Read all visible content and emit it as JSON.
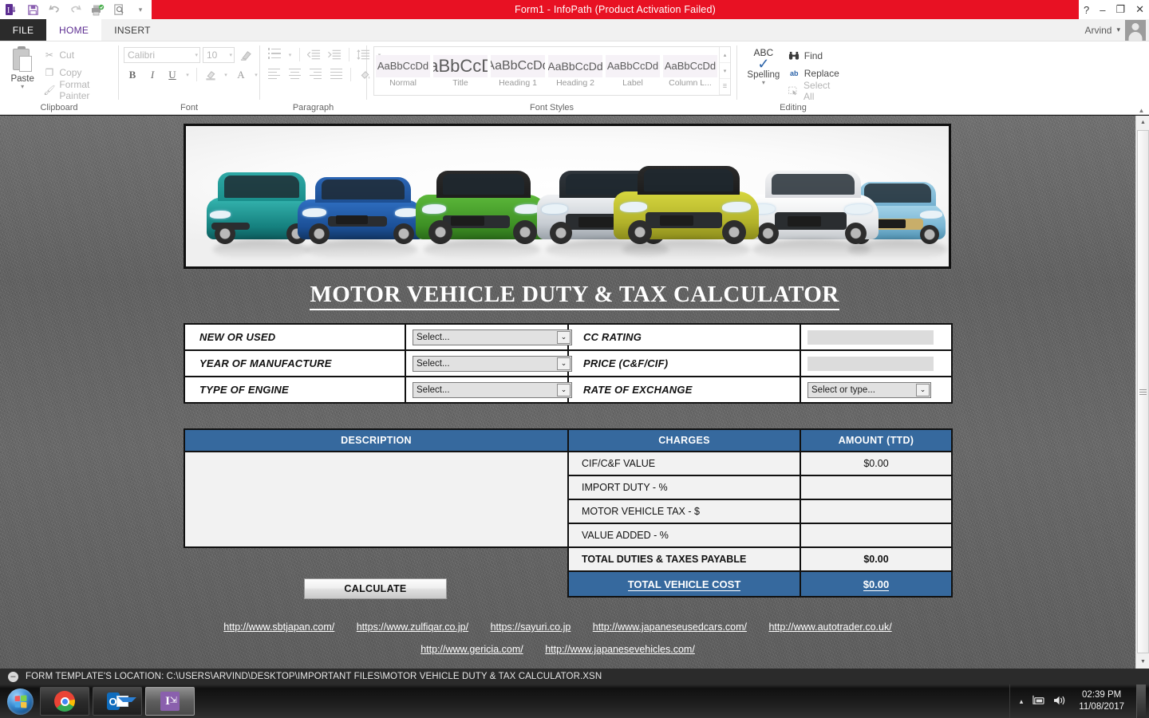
{
  "window": {
    "title": "Form1 -  InfoPath (Product Activation Failed)",
    "help_icon": "?",
    "minimize_icon": "–",
    "restore_icon": "❐",
    "close_icon": "✕",
    "user_name": "Arvind",
    "user_caret": "▾"
  },
  "quick_access": [
    {
      "name": "infopath-logo-icon",
      "glyph": "I"
    },
    {
      "name": "save-icon",
      "glyph": "▤"
    },
    {
      "name": "undo-icon",
      "glyph": "↶"
    },
    {
      "name": "redo-icon",
      "glyph": "↷"
    },
    {
      "name": "quick-publish-icon",
      "glyph": "⎙"
    },
    {
      "name": "preview-icon",
      "glyph": "🔍"
    },
    {
      "name": "customize-qat-icon",
      "glyph": "▾"
    }
  ],
  "tabs": {
    "file": "FILE",
    "items": [
      {
        "label": "HOME",
        "active": true
      },
      {
        "label": "INSERT",
        "active": false
      }
    ]
  },
  "ribbon": {
    "clipboard": {
      "group_label": "Clipboard",
      "paste_label": "Paste",
      "paste_caret": "▾",
      "commands": [
        {
          "label": "Cut",
          "icon": "scissors-icon",
          "glyph": "✂"
        },
        {
          "label": "Copy",
          "icon": "copy-icon",
          "glyph": "❐"
        },
        {
          "label": "Format Painter",
          "icon": "format-painter-icon",
          "glyph": "✎"
        }
      ]
    },
    "font": {
      "group_label": "Font",
      "font_name": "Calibri",
      "font_size": "10",
      "caret": "▾",
      "clear_formatting_icon": "clear-formatting-icon",
      "bold": "B",
      "italic": "I",
      "underline": "U",
      "highlight_icon": "text-highlight-icon",
      "font_color": "A"
    },
    "paragraph": {
      "group_label": "Paragraph",
      "bullets_icon": "bullet-list-icon",
      "decrease_indent_icon": "decrease-indent-icon",
      "increase_indent_icon": "increase-indent-icon",
      "line_spacing_icon": "line-spacing-icon",
      "align_left_icon": "align-left-icon",
      "align_center_icon": "align-center-icon",
      "align_right_icon": "align-right-icon",
      "justify_icon": "justify-icon",
      "shading_icon": "shading-icon"
    },
    "font_styles": {
      "group_label": "Font Styles",
      "styles": [
        {
          "preview": "AaBbCcDd",
          "name": "Normal",
          "size": "13px"
        },
        {
          "preview": "AaBbCcDd",
          "name": "Title",
          "size": "22px"
        },
        {
          "preview": "AaBbCcDd",
          "name": "Heading 1",
          "size": "16px"
        },
        {
          "preview": "AaBbCcDd",
          "name": "Heading 2",
          "size": "14px"
        },
        {
          "preview": "AaBbCcDd",
          "name": "Label",
          "size": "13px"
        },
        {
          "preview": "AaBbCcDd",
          "name": "Column L...",
          "size": "13px"
        }
      ],
      "scroll_up": "▴",
      "scroll_down": "▾",
      "scroll_more": "☰"
    },
    "editing": {
      "group_label": "Editing",
      "spelling_abc": "ABC",
      "spelling_label": "Spelling",
      "spelling_caret": "▾",
      "commands": [
        {
          "label": "Find",
          "icon": "binoculars-icon",
          "glyph": "🔍"
        },
        {
          "label": "Replace",
          "icon": "replace-icon",
          "glyph": "ab"
        },
        {
          "label": "Select All",
          "icon": "select-all-icon",
          "glyph": "▣"
        }
      ]
    },
    "collapse_ribbon_icon": "▲"
  },
  "form": {
    "banner_alt": "vehicle-lineup-banner",
    "title": "MOTOR VEHICLE DUTY & TAX CALCULATOR",
    "inputs": [
      {
        "label": "NEW OR USED",
        "control": "select",
        "value": "Select..."
      },
      {
        "label": "CC RATING",
        "control": "text",
        "value": ""
      },
      {
        "label": "YEAR OF MANUFACTURE",
        "control": "select",
        "value": "Select..."
      },
      {
        "label": "PRICE (C&F/CIF)",
        "control": "text",
        "value": ""
      },
      {
        "label": "TYPE OF ENGINE",
        "control": "select",
        "value": "Select..."
      },
      {
        "label": "RATE OF EXCHANGE",
        "control": "combo",
        "value": "Select or type..."
      }
    ],
    "table": {
      "headers": [
        "DESCRIPTION",
        "CHARGES",
        "AMOUNT (TTD)"
      ],
      "rows": [
        {
          "charge": "CIF/C&F VALUE",
          "amount": "$0.00",
          "bold": false
        },
        {
          "charge": "IMPORT DUTY -     %",
          "amount": "",
          "bold": false
        },
        {
          "charge": "MOTOR VEHICLE TAX - $",
          "amount": "",
          "bold": false
        },
        {
          "charge": "VALUE ADDED -       %",
          "amount": "",
          "bold": false
        }
      ],
      "total_row": {
        "charge": "TOTAL DUTIES & TAXES PAYABLE",
        "amount": "$0.00"
      },
      "grand_row": {
        "charge": "TOTAL VEHICLE COST",
        "amount": "$0.00"
      }
    },
    "calculate_button": "CALCULATE",
    "links_row1": [
      "http://www.sbtjapan.com/",
      "https://www.zulfiqar.co.jp/",
      "https://sayuri.co.jp",
      "http://www.japaneseusedcars.com/",
      "http://www.autotrader.co.uk/"
    ],
    "links_row2": [
      "http://www.gericia.com/",
      "http://www.japanesevehicles.com/"
    ],
    "dropdown_arrow": "⌄"
  },
  "colors": {
    "accent_blue": "#36699E",
    "title_red": "#e81123",
    "file_tab": "#2b2b2b",
    "active_tab_text": "#5c2d91"
  },
  "statusbar": {
    "icon": "minus-circle-icon",
    "icon_glyph": "–",
    "text": "FORM TEMPLATE'S LOCATION: C:\\USERS\\ARVIND\\DESKTOP\\IMPORTANT FILES\\MOTOR VEHICLE DUTY & TAX CALCULATOR.XSN"
  },
  "taskbar": {
    "start_button": "start-orb",
    "apps": [
      {
        "name": "taskbar-chrome",
        "active": false
      },
      {
        "name": "taskbar-outlook",
        "active": false
      },
      {
        "name": "taskbar-infopath",
        "active": true
      }
    ],
    "tray": {
      "show_hidden": "▴",
      "network_icon": "network-icon",
      "volume_icon": "🔊",
      "time": "02:39 PM",
      "date": "11/08/2017"
    }
  }
}
